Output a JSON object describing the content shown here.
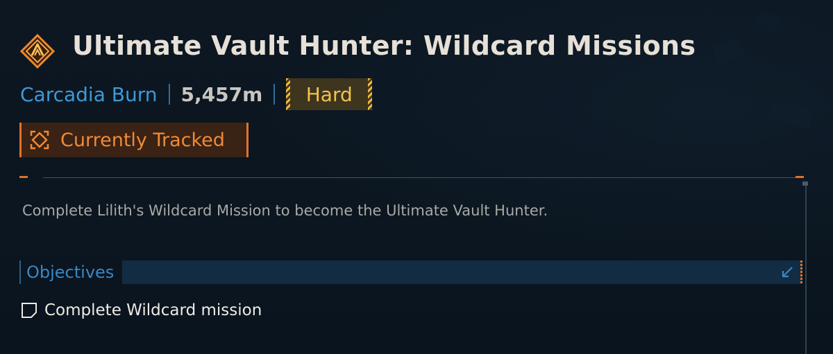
{
  "mission": {
    "title": "Ultimate Vault Hunter: Wildcard Missions",
    "icon": "vault-hunter-mission-icon",
    "location": "Carcadia Burn",
    "distance": "5,457m",
    "difficulty": "Hard",
    "tracked_label": "Currently Tracked",
    "description": "Complete Lilith's Wildcard Mission to become the Ultimate Vault Hunter."
  },
  "objectives": {
    "header": "Objectives",
    "items": [
      {
        "text": "Complete Wildcard mission",
        "completed": false
      }
    ]
  },
  "colors": {
    "background": "#0b1620",
    "accent_orange": "#e0742a",
    "accent_blue": "#3e9ad6",
    "difficulty_yellow": "#f3c34a",
    "title_text": "#e6e0d7"
  }
}
